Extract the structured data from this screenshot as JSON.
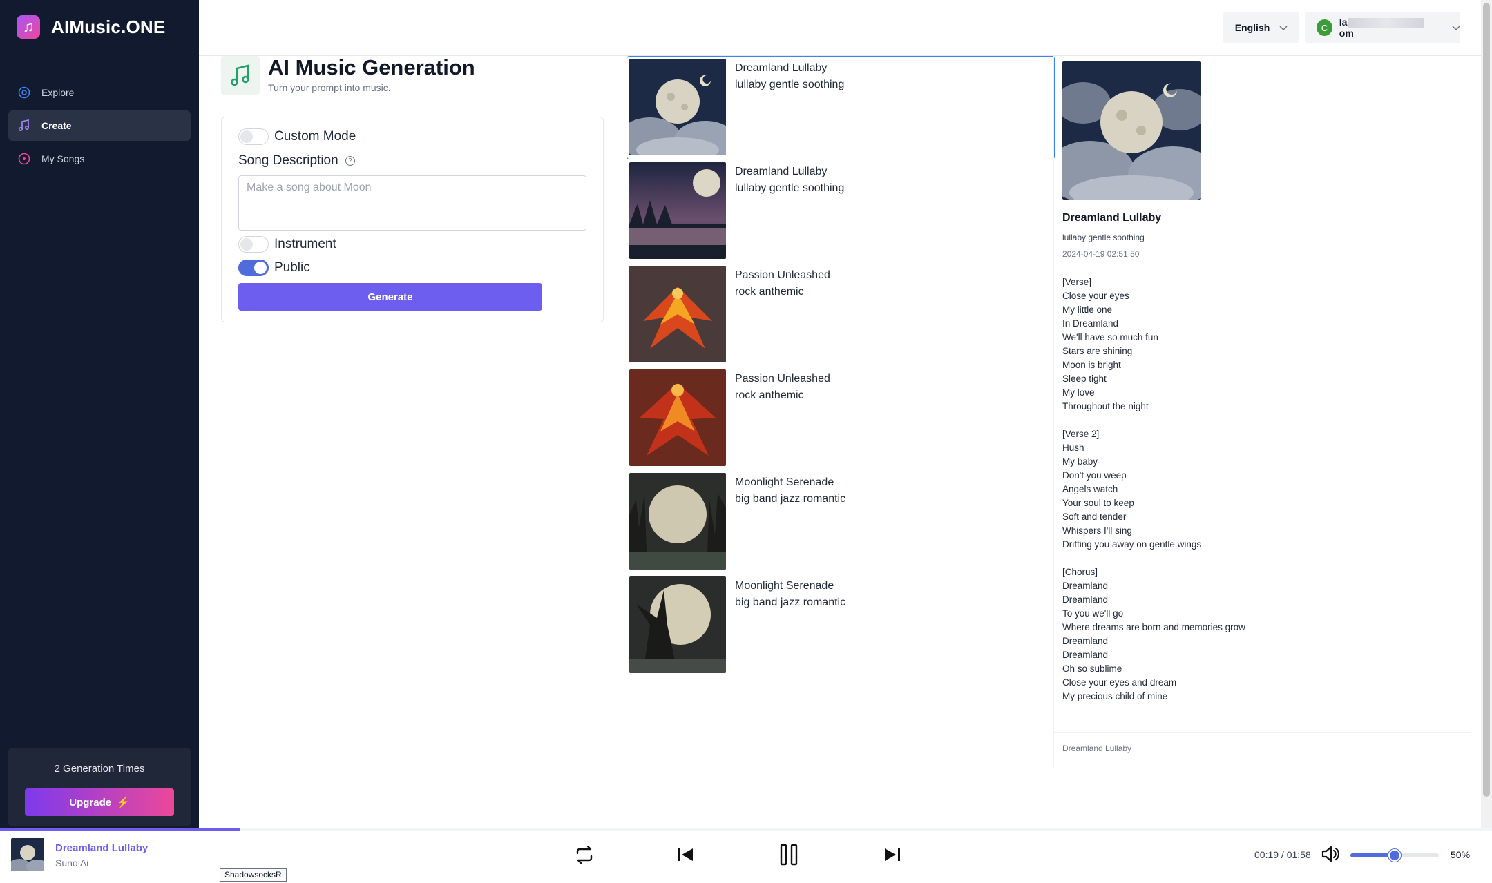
{
  "app": {
    "name": "AIMusic.ONE"
  },
  "sidebar": {
    "items": [
      {
        "label": "Explore",
        "icon": "compass-icon"
      },
      {
        "label": "Create",
        "icon": "music-note-icon"
      },
      {
        "label": "My Songs",
        "icon": "play-circle-icon"
      }
    ],
    "credits_text": "2 Generation Times",
    "upgrade_label": "Upgrade"
  },
  "topbar": {
    "language": "English",
    "user_avatar_letter": "C",
    "user_email_start": "la",
    "user_email_end": "om"
  },
  "header": {
    "title": "AI Music Generation",
    "subtitle": "Turn your prompt into music."
  },
  "form": {
    "custom_mode_label": "Custom Mode",
    "custom_mode_on": false,
    "description_label": "Song Description",
    "description_placeholder": "Make a song about Moon",
    "instrument_label": "Instrument",
    "instrument_on": false,
    "public_label": "Public",
    "public_on": true,
    "generate_label": "Generate"
  },
  "songs": [
    {
      "title": "Dreamland Lullaby",
      "tags": "lullaby gentle soothing",
      "art": "moon-clouds"
    },
    {
      "title": "Dreamland Lullaby",
      "tags": "lullaby gentle soothing",
      "art": "moon-lake"
    },
    {
      "title": "Passion Unleashed",
      "tags": "rock anthemic",
      "art": "phoenix"
    },
    {
      "title": "Passion Unleashed",
      "tags": "rock anthemic",
      "art": "phoenix"
    },
    {
      "title": "Moonlight Serenade",
      "tags": "big band jazz romantic",
      "art": "moon-forest"
    },
    {
      "title": "Moonlight Serenade",
      "tags": "big band jazz romantic",
      "art": "moon-forest"
    }
  ],
  "detail": {
    "title": "Dreamland Lullaby",
    "tags": "lullaby gentle soothing",
    "date": "2024-04-19 02:51:50",
    "lyrics": "[Verse]\nClose your eyes\nMy little one\nIn Dreamland\nWe'll have so much fun\nStars are shining\nMoon is bright\nSleep tight\nMy love\nThroughout the night\n\n[Verse 2]\nHush\nMy baby\nDon't you weep\nAngels watch\nYour soul to keep\nSoft and tender\nWhispers I'll sing\nDrifting you away on gentle wings\n\n[Chorus]\nDreamland\nDreamland\nTo you we'll go\nWhere dreams are born and memories grow\nDreamland\nDreamland\nOh so sublime\nClose your eyes and dream\nMy precious child of mine",
    "footer": "Dreamland Lullaby"
  },
  "player": {
    "title": "Dreamland Lullaby",
    "artist": "Suno Ai",
    "tooltip": "ShadowsocksR",
    "elapsed": "00:19",
    "duration": "01:58",
    "time_text": "00:19 / 01:58",
    "progress": 0.161,
    "volume": 0.5,
    "volume_text": "50%",
    "accent": "#6d5ef0"
  }
}
